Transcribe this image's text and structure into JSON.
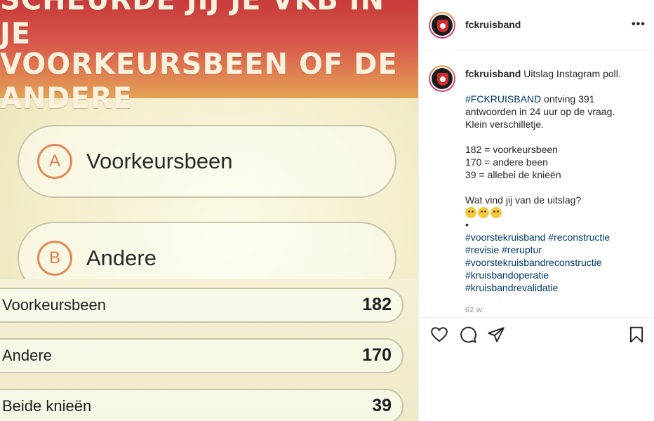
{
  "image": {
    "banner_line1": "SCHEURDE JIJ JE VKB IN JE",
    "banner_line2": "VOORKEURSBEEN OF DE ANDERE",
    "options": [
      {
        "letter": "A",
        "label": "Voorkeursbeen"
      },
      {
        "letter": "B",
        "label": "Andere"
      }
    ],
    "results": [
      {
        "label": "Voorkeursbeen",
        "count": "182"
      },
      {
        "label": "Andere",
        "count": "170"
      },
      {
        "label": "Beide knieën",
        "count": "39"
      }
    ]
  },
  "header": {
    "username": "fckruisband",
    "more_icon": "more-options-icon"
  },
  "caption": {
    "username": "fckruisband",
    "title": "Uitslag Instagram poll.",
    "hashtag_main": "#FCKRUISBAND",
    "line1_rest": "ontving 391",
    "line2": "antwoorden in 24 uur op de vraag.",
    "line3": "Klein verschilletje.",
    "stat1": "182 = voorkeursbeen",
    "stat2": "170 = andere been",
    "stat3": "39 = allebei de knieën",
    "question": "Wat vind jij van de uitslag?",
    "dot": "•",
    "tags_line1": "#voorstekruisband #reconstructie",
    "tags_line2": "#revisie #reruptur",
    "tags_line3": "#voorstekruisbandreconstructie",
    "tags_line4": "#kruisbandoperatie",
    "tags_line5": "#kruisbandrevalidatie"
  },
  "timestamp": "62 w.",
  "actions": [
    "heart-icon",
    "comment-icon",
    "share-icon",
    "bookmark-icon"
  ],
  "colors": {
    "hashtag": "#00376b",
    "text": "#262626",
    "muted": "#8e8e8e",
    "banner_top": "#c73a3a",
    "banner_bottom": "#e4a256"
  }
}
